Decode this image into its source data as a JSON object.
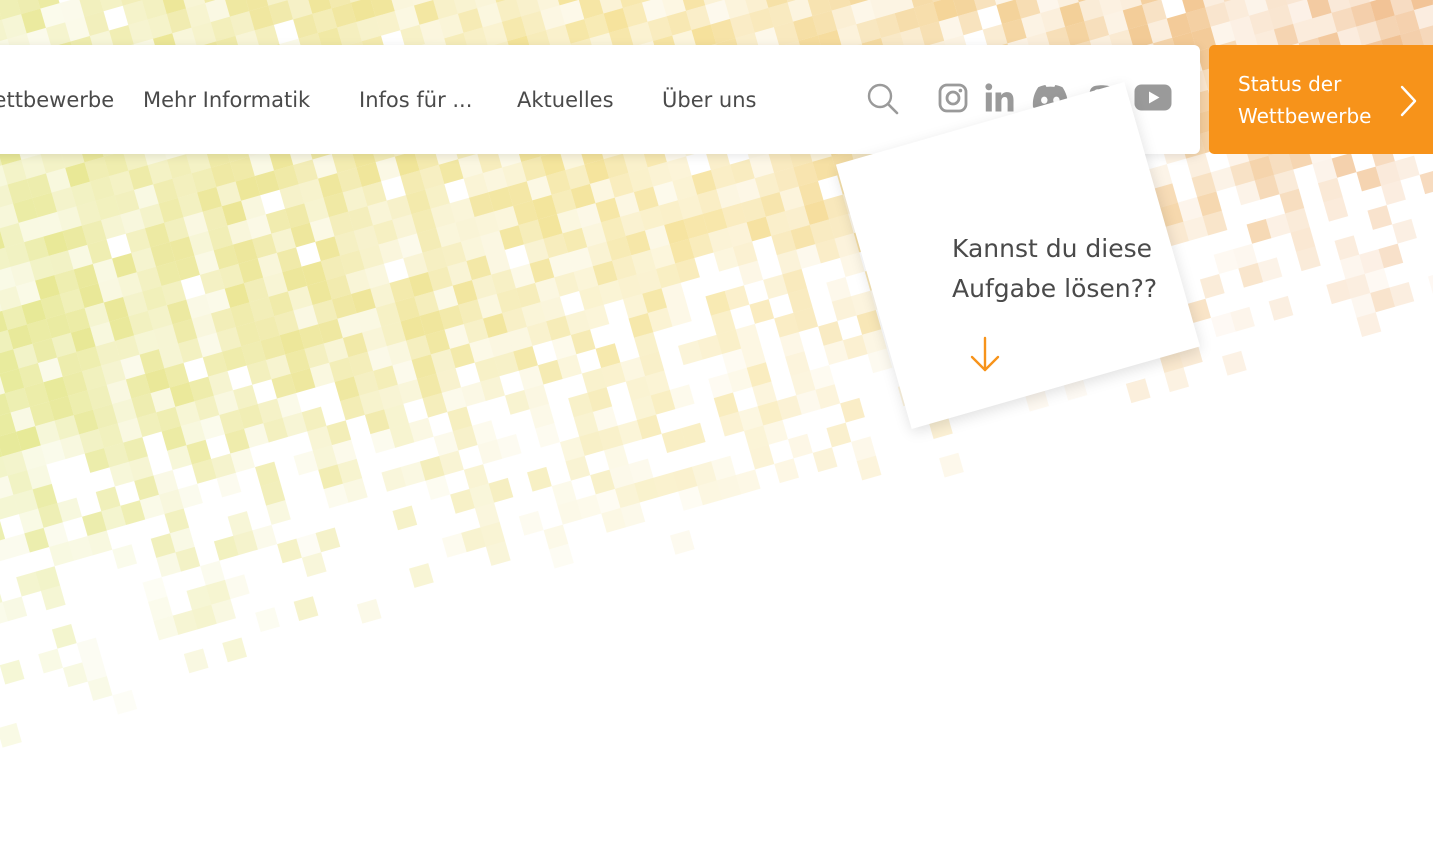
{
  "nav": {
    "items": [
      {
        "label": "Wettbewerbe"
      },
      {
        "label": "Mehr Informatik"
      },
      {
        "label": "Infos für ..."
      },
      {
        "label": "Aktuelles"
      },
      {
        "label": "Über uns"
      }
    ],
    "icons": [
      "search-icon",
      "instagram-icon",
      "linkedin-icon",
      "discord-icon",
      "mastodon-icon",
      "youtube-icon"
    ]
  },
  "status_button": {
    "label": "Status der Wettbewerbe",
    "icon": "chevron-right-icon"
  },
  "task_card": {
    "text": "Kannst du diese Aufgabe lösen??",
    "icon": "arrow-down-icon"
  },
  "colors": {
    "accent": "#f7931a",
    "text": "#4a4a4a",
    "icon": "#9a9a9a",
    "pixel_green": "#d6df5f",
    "pixel_yellow": "#f2d56a",
    "pixel_orange": "#eaa15a"
  }
}
